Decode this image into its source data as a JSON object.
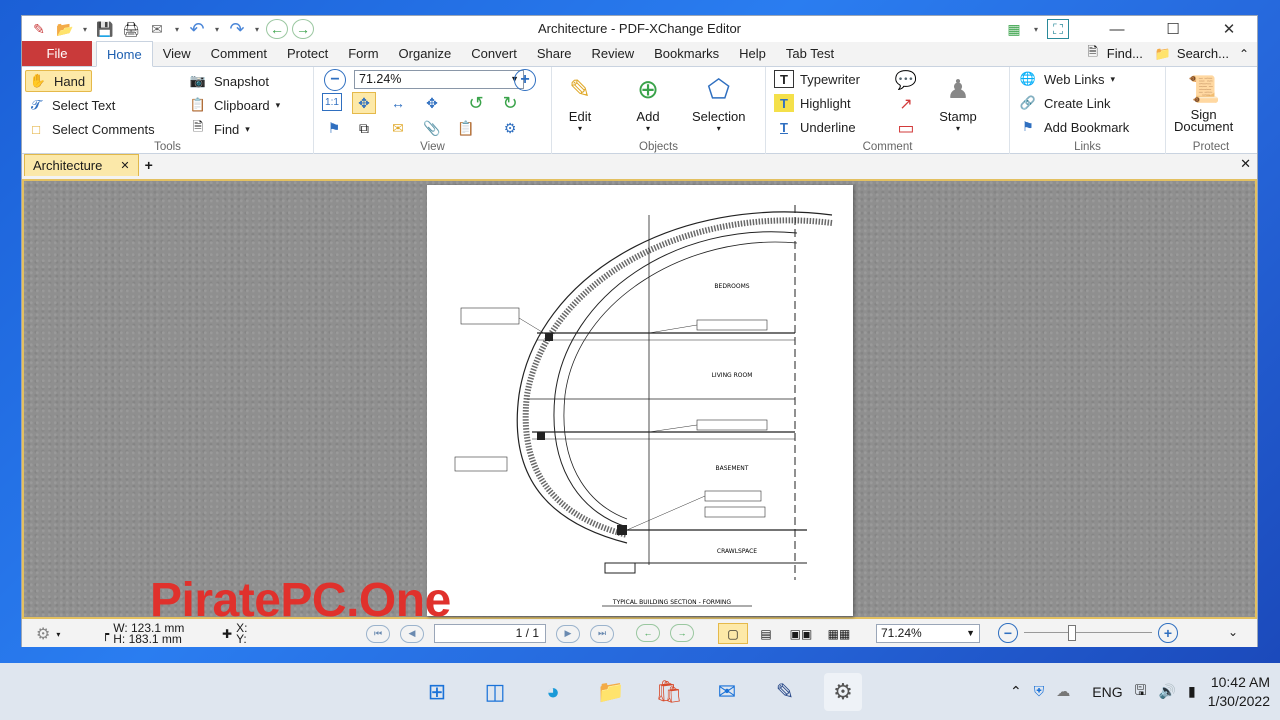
{
  "window": {
    "title": "Architecture - PDF-XChange Editor"
  },
  "titlebar": {
    "qat": [
      {
        "name": "app-logo-icon",
        "glyph": "✎"
      },
      {
        "name": "open-folder-icon",
        "glyph": "📂"
      },
      {
        "name": "save-icon",
        "glyph": "💾"
      },
      {
        "name": "print-icon",
        "glyph": "🖨"
      },
      {
        "name": "email-icon",
        "glyph": "✉"
      },
      {
        "name": "undo-icon",
        "glyph": "↶"
      },
      {
        "name": "redo-icon",
        "glyph": "↷"
      },
      {
        "name": "back-icon",
        "glyph": "←"
      },
      {
        "name": "forward-icon",
        "glyph": "→"
      }
    ],
    "controls": {
      "minimize": "—",
      "maximize": "☐",
      "close": "✕"
    }
  },
  "menu": {
    "file": "File",
    "tabs": [
      "Home",
      "View",
      "Comment",
      "Protect",
      "Form",
      "Organize",
      "Convert",
      "Share",
      "Review",
      "Bookmarks",
      "Help",
      "Tab Test"
    ],
    "active": "Home",
    "find": "Find...",
    "search": "Search..."
  },
  "ribbon": {
    "tools": {
      "label": "Tools",
      "hand": "Hand",
      "select_text": "Select Text",
      "select_comments": "Select Comments",
      "snapshot": "Snapshot",
      "clipboard": "Clipboard",
      "find": "Find"
    },
    "view": {
      "label": "View",
      "zoom": "71.24%"
    },
    "objects": {
      "label": "Objects",
      "edit": "Edit",
      "add": "Add",
      "selection": "Selection"
    },
    "comment": {
      "label": "Comment",
      "typewriter": "Typewriter",
      "highlight": "Highlight",
      "underline": "Underline",
      "stamp": "Stamp"
    },
    "links": {
      "label": "Links",
      "web_links": "Web Links",
      "create_link": "Create Link",
      "add_bookmark": "Add Bookmark"
    },
    "protect": {
      "label": "Protect",
      "sign": "Sign",
      "document": "Document"
    }
  },
  "doctabs": {
    "tab": "Architecture"
  },
  "drawing": {
    "rooms": [
      "BEDROOMS",
      "LIVING ROOM",
      "BASEMENT",
      "CRAWLSPACE"
    ],
    "caption": "TYPICAL BUILDING SECTION - FORMING"
  },
  "watermark": "PiratePC.One",
  "statusbar": {
    "w": "W: 123.1 mm",
    "h": "H: 183.1 mm",
    "x": "X:",
    "y": "Y:",
    "page": "1 / 1",
    "zoom": "71.24%"
  },
  "taskbar": {
    "lang": "ENG",
    "time": "10:42 AM",
    "date": "1/30/2022"
  },
  "colors": {
    "file_tab": "#c93a3a",
    "accent": "#1d5fb0",
    "selected": "#fde9a8",
    "watermark": "#e0312c"
  }
}
